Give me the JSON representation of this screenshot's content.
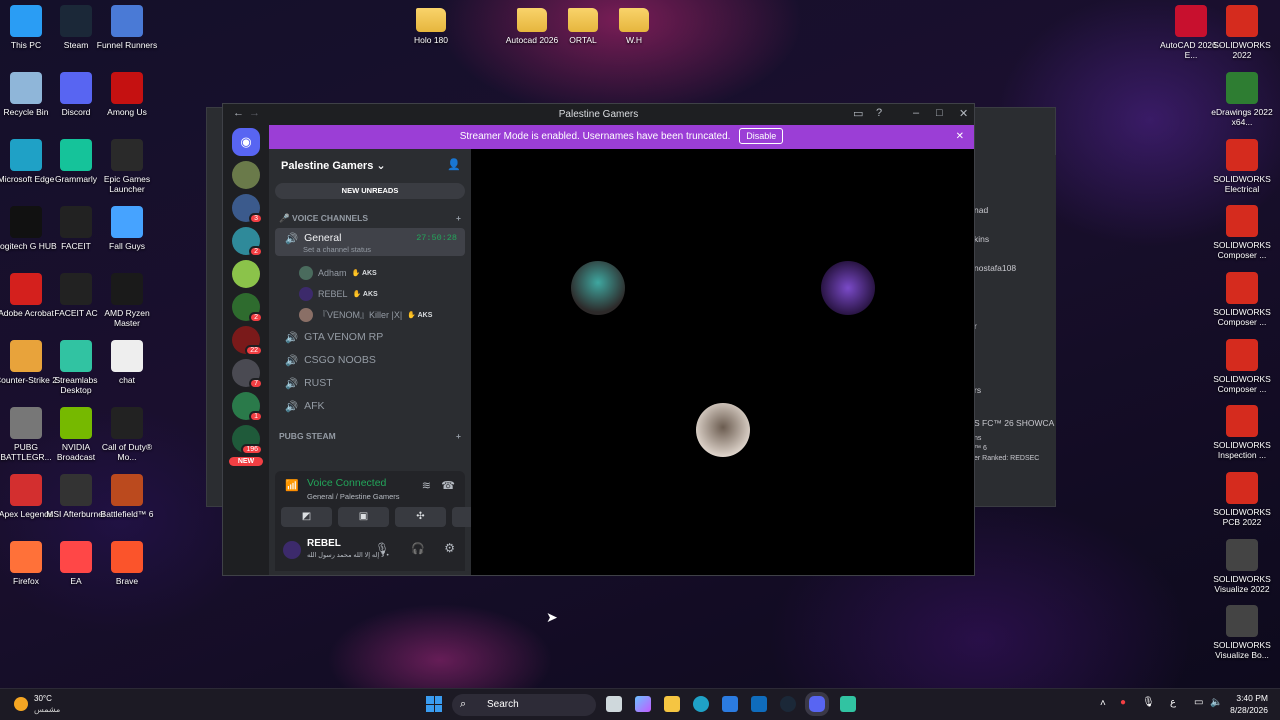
{
  "desktop": {
    "left_icons": [
      {
        "label": "This PC",
        "color": "#2a9df4",
        "icon": "monitor-icon"
      },
      {
        "label": "Steam",
        "color": "#1b2838",
        "icon": "steam-icon"
      },
      {
        "label": "Funnel Runners",
        "color": "#4a7ad6",
        "icon": "game-icon"
      },
      {
        "label": "Recycle Bin",
        "color": "#8fb6d9",
        "icon": "recycle-bin-icon"
      },
      {
        "label": "Discord",
        "color": "#5865f2",
        "icon": "discord-icon"
      },
      {
        "label": "Among Us",
        "color": "#c51111",
        "icon": "among-us-icon"
      },
      {
        "label": "Microsoft Edge",
        "color": "#1fa1c6",
        "icon": "edge-icon"
      },
      {
        "label": "Grammarly",
        "color": "#15c39a",
        "icon": "grammarly-icon"
      },
      {
        "label": "Epic Games Launcher",
        "color": "#2a2a2a",
        "icon": "epic-icon"
      },
      {
        "label": "Logitech G HUB",
        "color": "#111111",
        "icon": "logitech-icon"
      },
      {
        "label": "FACEIT",
        "color": "#222222",
        "icon": "faceit-icon"
      },
      {
        "label": "Fall Guys",
        "color": "#46a3ff",
        "icon": "fall-guys-icon"
      },
      {
        "label": "Adobe Acrobat",
        "color": "#d4201d",
        "icon": "acrobat-icon"
      },
      {
        "label": "FACEIT AC",
        "color": "#222222",
        "icon": "faceit-ac-icon"
      },
      {
        "label": "AMD Ryzen Master",
        "color": "#1a1a1a",
        "icon": "ryzen-icon"
      },
      {
        "label": "Counter-Strike 2",
        "color": "#e8a33b",
        "icon": "cs2-icon"
      },
      {
        "label": "Streamlabs Desktop",
        "color": "#31c3a2",
        "icon": "streamlabs-icon"
      },
      {
        "label": "chat",
        "color": "#eeeeee",
        "icon": "text-file-icon"
      },
      {
        "label": "PUBG BATTLEGR...",
        "color": "#777777",
        "icon": "pubg-icon"
      },
      {
        "label": "NVIDIA Broadcast",
        "color": "#76b900",
        "icon": "nvidia-icon"
      },
      {
        "label": "Call of Duty® Mo...",
        "color": "#222222",
        "icon": "cod-icon"
      },
      {
        "label": "Apex Legends",
        "color": "#d32f2f",
        "icon": "apex-icon"
      },
      {
        "label": "MSI Afterburner",
        "color": "#333333",
        "icon": "msi-icon"
      },
      {
        "label": "Battlefield™ 6",
        "color": "#bb4a1e",
        "icon": "battlefield-icon"
      },
      {
        "label": "Firefox",
        "color": "#ff7139",
        "icon": "firefox-icon"
      },
      {
        "label": "EA",
        "color": "#ff4747",
        "icon": "ea-icon"
      },
      {
        "label": "Brave",
        "color": "#fb542b",
        "icon": "brave-icon"
      }
    ],
    "top_folders": [
      "Holo 180",
      "Autocad 2026",
      "ORTAL",
      "W.H"
    ],
    "right_icons": [
      {
        "label": "AutoCAD 2026 - E...",
        "color": "#c8102e",
        "icon": "autocad-icon"
      },
      {
        "label": "SOLIDWORKS 2022",
        "color": "#d52b1e",
        "icon": "solidworks-icon"
      },
      {
        "label": "eDrawings 2022 x64...",
        "color": "#2e7d32",
        "icon": "edrawings-icon"
      },
      {
        "label": "SOLIDWORKS Electrical",
        "color": "#d52b1e",
        "icon": "solidworks-icon"
      },
      {
        "label": "SOLIDWORKS Composer ...",
        "color": "#d52b1e",
        "icon": "solidworks-icon"
      },
      {
        "label": "SOLIDWORKS Composer ...",
        "color": "#d52b1e",
        "icon": "solidworks-icon"
      },
      {
        "label": "SOLIDWORKS Composer ...",
        "color": "#d52b1e",
        "icon": "solidworks-icon"
      },
      {
        "label": "SOLIDWORKS Inspection ...",
        "color": "#d52b1e",
        "icon": "solidworks-icon"
      },
      {
        "label": "SOLIDWORKS PCB 2022",
        "color": "#d52b1e",
        "icon": "solidworks-icon"
      },
      {
        "label": "SOLIDWORKS Visualize 2022",
        "color": "#444444",
        "icon": "visualize-icon"
      },
      {
        "label": "SOLIDWORKS Visualize Bo...",
        "color": "#444444",
        "icon": "visualize-icon"
      }
    ]
  },
  "ghost_window": {
    "lines": [
      "nad",
      "kins",
      "nostafa108",
      "r",
      "rs",
      "S FC™ 26 SHOWCA",
      "ns",
      "™ 6",
      "er Ranked: REDSEC"
    ]
  },
  "discord": {
    "window_title": "Palestine Gamers",
    "streamer_banner": "Streamer Mode is enabled. Usernames have been truncated.",
    "disable_label": "Disable",
    "server_name": "Palestine Gamers",
    "new_unreads": "NEW UNREADS",
    "voice_category": "VOICE CHANNELS",
    "active_channel": {
      "name": "General",
      "timer": "27:50:28",
      "status": "Set a channel status"
    },
    "members": [
      {
        "name": "Adham",
        "tag": "AKS",
        "color": "#4a6b5d"
      },
      {
        "name": "REBEL",
        "tag": "AKS",
        "color": "#3c2a6b"
      },
      {
        "name": "『VENOM』Killer |X|",
        "tag": "AKS",
        "color": "#8a6f66"
      }
    ],
    "channels": [
      "GTA VENOM RP",
      "CSGO NOOBS",
      "RUST",
      "AFK"
    ],
    "pubg_category": "PUBG STEAM",
    "guild_badges": [
      "3",
      "2",
      "2",
      "22",
      "7",
      "1",
      "196"
    ],
    "new_badge": "NEW",
    "voice_connected": "Voice Connected",
    "voice_location": "General / Palestine Gamers",
    "user": {
      "name": "REBEL",
      "status": "لا إله إلا الله محمد رسول الله •"
    },
    "tile_colors": [
      "#223830",
      "#1f1330",
      "#d9c0b0"
    ]
  },
  "taskbar": {
    "weather_temp": "30°C",
    "weather_desc": "مشمس",
    "search_placeholder": "Search",
    "time": "3:40 PM",
    "date": "8/28/2026",
    "lang": "ع"
  }
}
